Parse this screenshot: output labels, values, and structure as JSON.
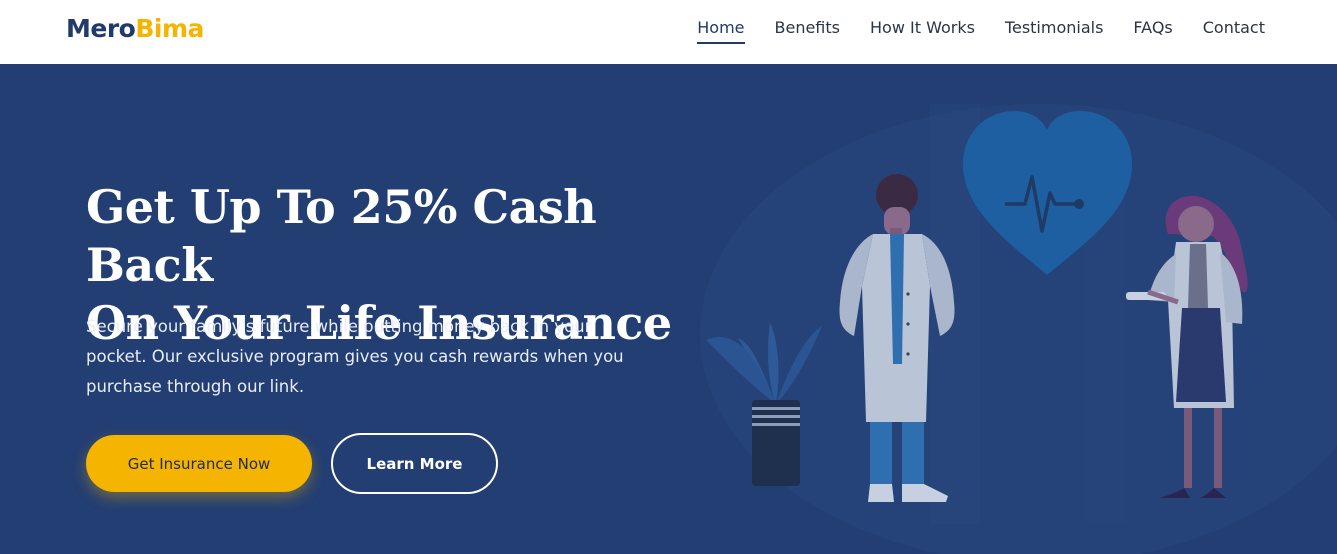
{
  "brand": {
    "name_part1": "Mero",
    "name_part2": "Bima",
    "color_primary": "#1f3a6b",
    "color_accent": "#f5b400"
  },
  "nav": {
    "items": [
      {
        "label": "Home",
        "active": true
      },
      {
        "label": "Benefits",
        "active": false
      },
      {
        "label": "How It Works",
        "active": false
      },
      {
        "label": "Testimonials",
        "active": false
      },
      {
        "label": "FAQs",
        "active": false
      },
      {
        "label": "Contact",
        "active": false
      }
    ]
  },
  "hero": {
    "title_line1": "Get Up To 25% Cash Back",
    "title_line2": "On Your Life Insurance",
    "description": "Secure your family's future while putting money back in your pocket. Our exclusive program gives you cash rewards when you purchase through our link.",
    "primary_button": "Get Insurance Now",
    "secondary_button": "Learn More",
    "background_color": "#233e72"
  }
}
